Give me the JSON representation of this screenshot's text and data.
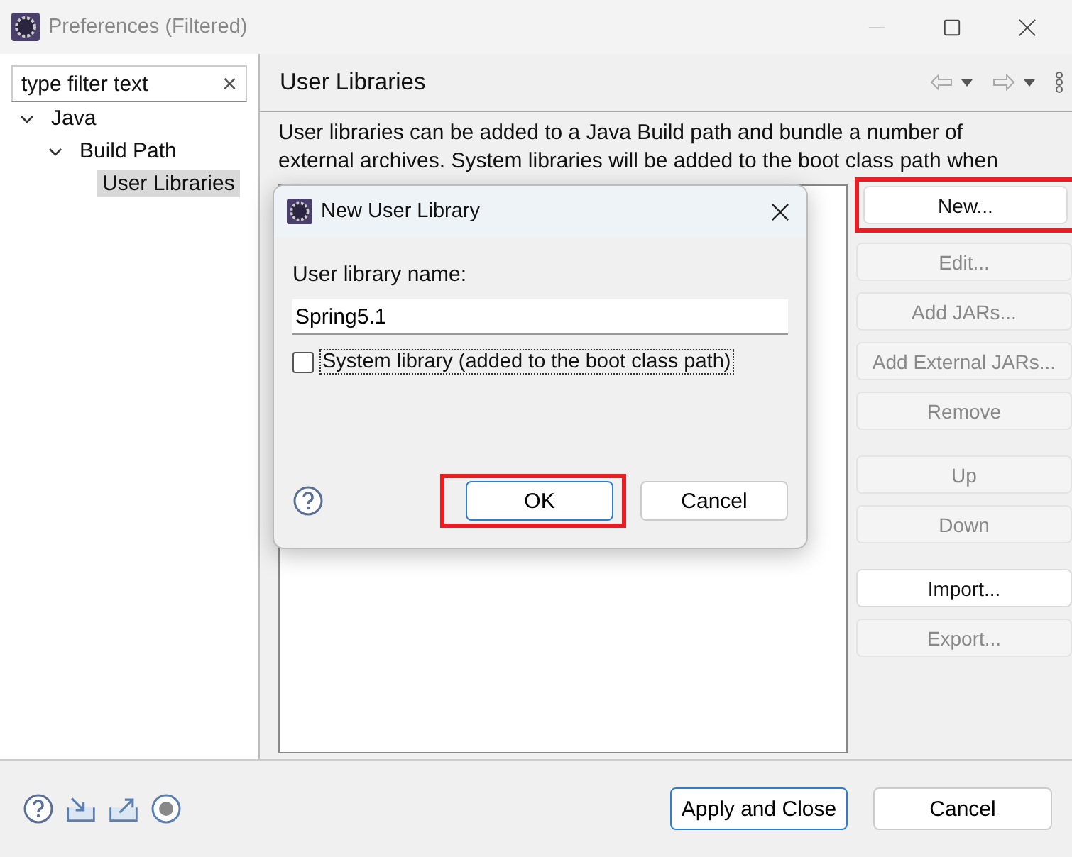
{
  "window": {
    "title": "Preferences (Filtered)"
  },
  "filter": {
    "placeholder": "type filter text",
    "clear_icon": "×"
  },
  "tree": [
    {
      "label": "Java",
      "expanded": true,
      "selected": false,
      "children": [
        {
          "label": "Build Path",
          "expanded": true,
          "selected": false,
          "children": [
            {
              "label": "User Libraries",
              "selected": true
            }
          ]
        }
      ]
    }
  ],
  "page": {
    "title": "User Libraries",
    "description": "User libraries can be added to a Java Build path and bundle a number of external archives. System libraries will be added to the boot class path when"
  },
  "side_button_groups": [
    [
      {
        "label": "New...",
        "disabled": false,
        "highlighted": true
      },
      {
        "label": "Edit...",
        "disabled": true,
        "highlighted": false
      },
      {
        "label": "Add JARs...",
        "disabled": true,
        "highlighted": false
      },
      {
        "label": "Add External JARs...",
        "disabled": true,
        "highlighted": false
      },
      {
        "label": "Remove",
        "disabled": true,
        "highlighted": false
      }
    ],
    [
      {
        "label": "Up",
        "disabled": true,
        "highlighted": false
      },
      {
        "label": "Down",
        "disabled": true,
        "highlighted": false
      }
    ],
    [
      {
        "label": "Import...",
        "disabled": false,
        "highlighted": false
      },
      {
        "label": "Export...",
        "disabled": true,
        "highlighted": false
      }
    ]
  ],
  "dialog": {
    "title": "New User Library",
    "name_label": "User library name:",
    "name_value": "Spring5.1",
    "system_checkbox": {
      "label": "System library (added to the boot class path)",
      "checked": false
    },
    "buttons": [
      {
        "label": "OK",
        "default": true,
        "highlighted": true
      },
      {
        "label": "Cancel",
        "default": false,
        "highlighted": false
      }
    ]
  },
  "footer_buttons": [
    {
      "label": "Apply and Close",
      "default": true
    },
    {
      "label": "Cancel",
      "default": false
    }
  ]
}
